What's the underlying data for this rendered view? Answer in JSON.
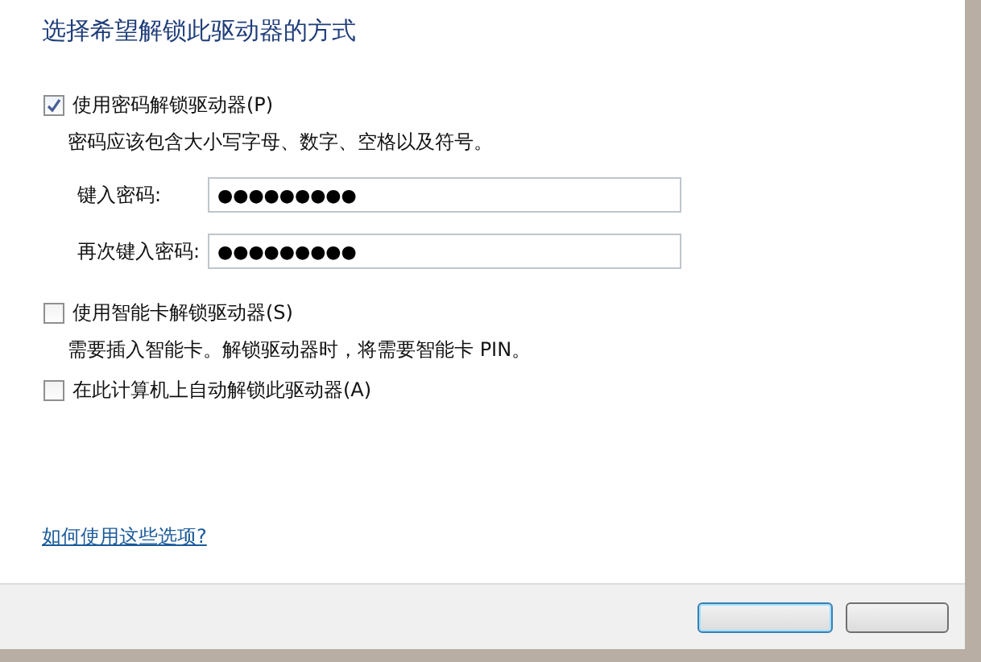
{
  "heading": "选择希望解锁此驱动器的方式",
  "options": [
    {
      "label": "使用密码解锁驱动器(P)",
      "checked": true,
      "description": "密码应该包含大小写字母、数字、空格以及符号。",
      "fields": [
        {
          "label": "键入密码:",
          "value": "●●●●●●●●●"
        },
        {
          "label": "再次键入密码:",
          "value": "●●●●●●●●●"
        }
      ]
    },
    {
      "label": "使用智能卡解锁驱动器(S)",
      "checked": false,
      "description": "需要插入智能卡。解锁驱动器时，将需要智能卡 PIN。"
    },
    {
      "label": "在此计算机上自动解锁此驱动器(A)",
      "checked": false
    }
  ],
  "help_link": "如何使用这些选项?",
  "footer_buttons": [
    {
      "kind": "default"
    },
    {
      "kind": "normal"
    }
  ]
}
